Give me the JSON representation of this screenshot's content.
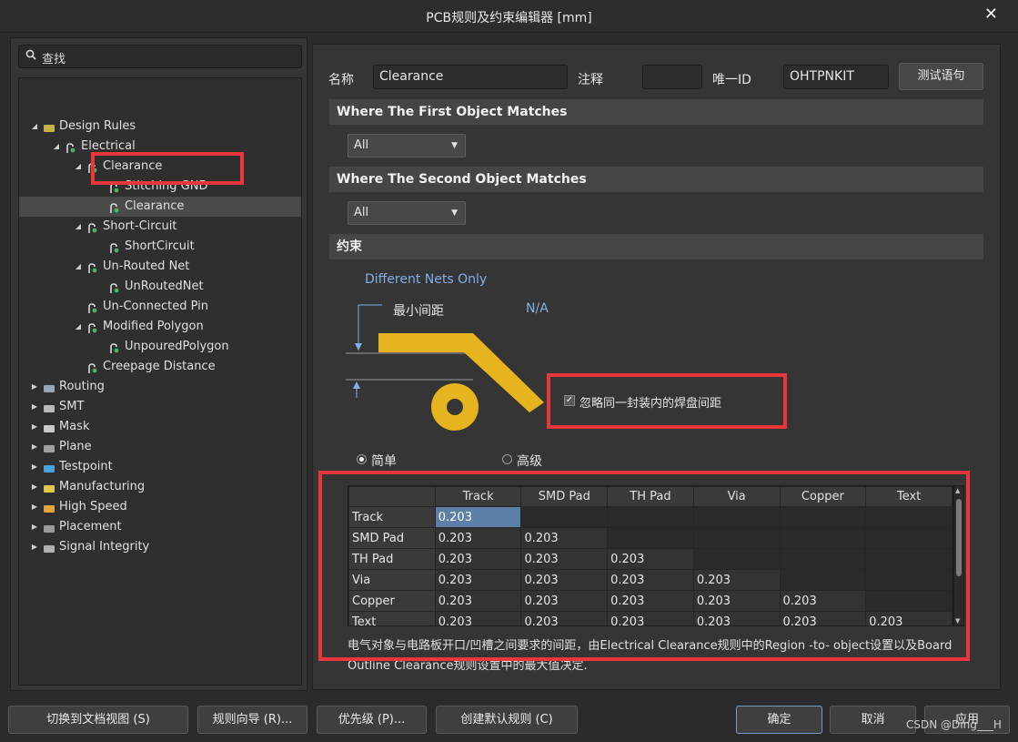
{
  "window": {
    "title": "PCB规则及约束编辑器 [mm]",
    "close_glyph": "✕"
  },
  "search": {
    "placeholder": "查找"
  },
  "tree": {
    "nodes": [
      {
        "label": "Design Rules",
        "arrow": "◢",
        "icon": "rules-folder-icon",
        "color": "#c8b04a"
      },
      {
        "label": "Electrical",
        "arrow": "◢",
        "icon": "rule-icon"
      },
      {
        "label": "Clearance",
        "arrow": "◢",
        "icon": "rule-icon"
      },
      {
        "label": "Stitching GND",
        "arrow": "",
        "icon": "rule-icon"
      },
      {
        "label": "Clearance",
        "arrow": "",
        "icon": "rule-icon"
      },
      {
        "label": "Short-Circuit",
        "arrow": "◢",
        "icon": "rule-icon"
      },
      {
        "label": "ShortCircuit",
        "arrow": "",
        "icon": "rule-icon"
      },
      {
        "label": "Un-Routed Net",
        "arrow": "◢",
        "icon": "rule-icon"
      },
      {
        "label": "UnRoutedNet",
        "arrow": "",
        "icon": "rule-icon"
      },
      {
        "label": "Un-Connected Pin",
        "arrow": "",
        "icon": "rule-icon"
      },
      {
        "label": "Modified Polygon",
        "arrow": "◢",
        "icon": "rule-icon"
      },
      {
        "label": "UnpouredPolygon",
        "arrow": "",
        "icon": "rule-icon"
      },
      {
        "label": "Creepage Distance",
        "arrow": "",
        "icon": "rule-icon"
      },
      {
        "label": "Routing",
        "arrow": "▶",
        "icon": "routing-icon"
      },
      {
        "label": "SMT",
        "arrow": "▶",
        "icon": "smt-icon"
      },
      {
        "label": "Mask",
        "arrow": "▶",
        "icon": "mask-icon"
      },
      {
        "label": "Plane",
        "arrow": "▶",
        "icon": "plane-icon"
      },
      {
        "label": "Testpoint",
        "arrow": "▶",
        "icon": "testpoint-icon"
      },
      {
        "label": "Manufacturing",
        "arrow": "▶",
        "icon": "manufacturing-icon"
      },
      {
        "label": "High Speed",
        "arrow": "▶",
        "icon": "high-speed-icon"
      },
      {
        "label": "Placement",
        "arrow": "▶",
        "icon": "placement-icon"
      },
      {
        "label": "Signal Integrity",
        "arrow": "▶",
        "icon": "signal-integrity-icon"
      }
    ]
  },
  "rule": {
    "name_label": "名称",
    "name_value": "Clearance",
    "comment_label": "注释",
    "comment_value": "",
    "uid_label": "唯一ID",
    "uid_value": "OHTPNKIT",
    "test_button": "测试语句"
  },
  "first_match": {
    "header": "Where The First Object Matches",
    "value": "All"
  },
  "second_match": {
    "header": "Where The Second Object Matches",
    "value": "All"
  },
  "constraints": {
    "header": "约束",
    "different_nets": "Different Nets Only",
    "min_clearance_label": "最小间距",
    "min_clearance_value": "N/A",
    "ignore_pads_label": "忽略同一封装内的焊盘间距",
    "ignore_pads_checked": true,
    "mode_simple": "简单",
    "mode_advanced": "高级",
    "selected_mode": "简单"
  },
  "matrix": {
    "columns": [
      "Track",
      "SMD Pad",
      "TH Pad",
      "Via",
      "Copper",
      "Text"
    ],
    "rows": [
      {
        "label": "Track",
        "cells": [
          "0.203",
          "",
          "",
          "",
          "",
          ""
        ]
      },
      {
        "label": "SMD Pad",
        "cells": [
          "0.203",
          "0.203",
          "",
          "",
          "",
          ""
        ]
      },
      {
        "label": "TH Pad",
        "cells": [
          "0.203",
          "0.203",
          "0.203",
          "",
          "",
          ""
        ]
      },
      {
        "label": "Via",
        "cells": [
          "0.203",
          "0.203",
          "0.203",
          "0.203",
          "",
          ""
        ]
      },
      {
        "label": "Copper",
        "cells": [
          "0.203",
          "0.203",
          "0.203",
          "0.203",
          "0.203",
          ""
        ]
      },
      {
        "label": "Text",
        "cells": [
          "0.203",
          "0.203",
          "0.203",
          "0.203",
          "0.203",
          "0.203"
        ]
      }
    ],
    "description": "电气对象与电路板开口/凹槽之间要求的间距，由Electrical Clearance规则中的Region -to- object设置以及Board Outline Clearance规则设置中的最大值决定."
  },
  "footer": {
    "doc_view": "切换到文档视图 (S)",
    "wizard": "规则向导 (R)...",
    "priority": "优先级 (P)...",
    "default_rules": "创建默认规则 (C)",
    "ok": "确定",
    "cancel": "取消",
    "apply": "应用"
  },
  "watermark": "CSDN @Ding___H",
  "colors": {
    "accent_red": "#e8363a",
    "track_yellow": "#e6b41e",
    "selection_blue": "#5b7fa6"
  }
}
